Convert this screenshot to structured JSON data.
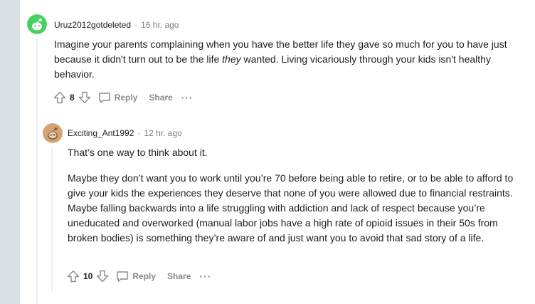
{
  "comments": [
    {
      "username": "Uruz2012gotdeleted",
      "separator": "·",
      "time": "16 hr. ago",
      "body_before": "Imagine your parents complaining when you have the better life they gave so much for you to have just because it didn't turn out to be the life ",
      "body_italic": "they",
      "body_after": " wanted. Living vicariously through your kids isn't healthy behavior.",
      "votes": "8",
      "reply_label": "Reply",
      "share_label": "Share",
      "more_label": "···",
      "avatar_color": "#46d160"
    },
    {
      "username": "Exciting_Ant1992",
      "separator": "·",
      "time": "12 hr. ago",
      "paragraphs": [
        "That’s one way to think about it.",
        "Maybe they don’t want you to work until you’re 70 before being able to retire, or to be able to afford to give your kids the experiences they deserve that none of you were allowed due to financial restraints. Maybe falling backwards into a life struggling with addiction and lack of respect because you’re uneducated and overworked (manual labor jobs have a high rate of opioid issues in their 50s from broken bodies) is something they’re aware of and just want you to avoid that sad story of a life."
      ],
      "votes": "10",
      "reply_label": "Reply",
      "share_label": "Share",
      "more_label": "···",
      "avatar_color": "#d4a373"
    }
  ],
  "icons": {
    "upvote": "upvote-icon",
    "downvote": "downvote-icon",
    "reply": "comment-bubble-icon",
    "more": "more-icon"
  },
  "colors": {
    "gutter": "#dae0e6",
    "action_text": "#878a8c",
    "meta_text": "#7c7c7c"
  }
}
